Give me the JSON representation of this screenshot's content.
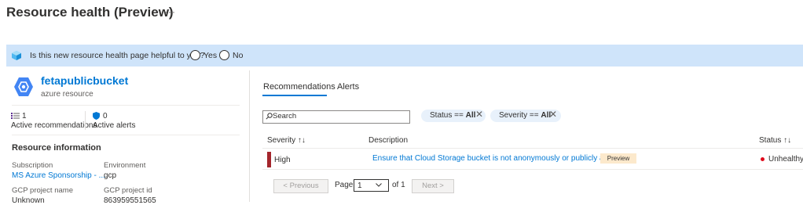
{
  "header": {
    "title": "Resource health (Preview)",
    "more": "···"
  },
  "banner": {
    "question": "Is this new resource health page helpful to you?",
    "yes": "Yes",
    "no": "No",
    "bg_color": "#cfe4fa"
  },
  "resource": {
    "name": "fetapublicbucket",
    "type": "azure resource",
    "icon": "gcp-hexagon-icon",
    "stats": [
      {
        "value": "1",
        "label": "Active recommendations",
        "icon": "list-icon"
      },
      {
        "value": "0",
        "label": "Active alerts",
        "icon": "shield-icon"
      }
    ],
    "info_title": "Resource information",
    "fields": [
      {
        "label": "Subscription",
        "value": "MS Azure Sponsorship - ...",
        "link": true
      },
      {
        "label": "Environment",
        "value": "gcp",
        "link": false
      },
      {
        "label": "GCP project name",
        "value": "Unknown",
        "link": false
      },
      {
        "label": "GCP project id",
        "value": "863959551565",
        "link": false
      }
    ]
  },
  "tabs": [
    {
      "label": "Recommendations",
      "active": true
    },
    {
      "label": "Alerts",
      "active": false
    }
  ],
  "filters": {
    "search_placeholder": "Search",
    "pills": [
      {
        "prefix": "Status == ",
        "value": "All"
      },
      {
        "prefix": "Severity == ",
        "value": "All"
      }
    ]
  },
  "table": {
    "columns": {
      "severity": "Severity ↑↓",
      "description": "Description",
      "status": "Status ↑↓"
    },
    "rows": [
      {
        "severity": "High",
        "description": "Ensure that Cloud Storage bucket is not anonymously or publicly accessible",
        "badge": "Preview",
        "status": "Unhealthy",
        "severity_color": "#a4262c"
      }
    ]
  },
  "pagination": {
    "previous": "< Previous",
    "page_label": "Page",
    "page_value": "1",
    "of_label": "of 1",
    "next": "Next >"
  },
  "colors": {
    "accent": "#0078d4",
    "danger": "#a4262c"
  }
}
